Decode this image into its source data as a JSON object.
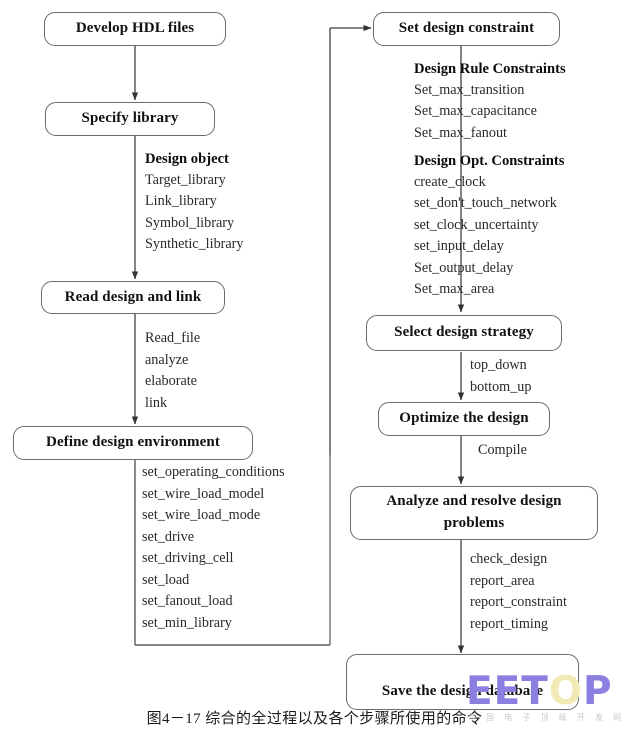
{
  "figure": {
    "caption": "图4－17  综合的全过程以及各个步骤所使用的命令",
    "watermark_main": "EETOP",
    "watermark_o": "O",
    "watermark_sub": "中 国 电 子 顶 级 开 发 网"
  },
  "nodes": {
    "develop_hdl": "Develop HDL files",
    "specify_library": "Specify library",
    "read_design": "Read design and link",
    "define_env": "Define design environment",
    "set_constraint": "Set design constraint",
    "select_strategy": "Select design strategy",
    "optimize": "Optimize the design",
    "analyze_line1": "Analyze and resolve design",
    "analyze_line2": "problems",
    "save_db": "Save the design database"
  },
  "lists": {
    "design_object": {
      "header": "Design object",
      "items": [
        "Target_library",
        "Link_library",
        "Symbol_library",
        "Synthetic_library"
      ]
    },
    "read_design_cmds": {
      "items": [
        "Read_file",
        "analyze",
        "elaborate",
        "link"
      ]
    },
    "define_env_cmds": {
      "items": [
        "set_operating_conditions",
        "set_wire_load_model",
        "set_wire_load_mode",
        "set_drive",
        "set_driving_cell",
        "set_load",
        "set_fanout_load",
        "set_min_library"
      ]
    },
    "design_rule_constraints": {
      "header": "Design Rule Constraints",
      "items": [
        "Set_max_transition",
        "Set_max_capacitance",
        "Set_max_fanout"
      ]
    },
    "design_opt_constraints": {
      "header": "Design Opt. Constraints",
      "items": [
        "create_clock",
        "set_don't_touch_network",
        "set_clock_uncertainty",
        "set_input_delay",
        "Set_output_delay",
        "Set_max_area"
      ]
    },
    "strategy_cmds": {
      "items": [
        "top_down",
        "bottom_up"
      ]
    },
    "optimize_cmds": {
      "items": [
        "Compile"
      ]
    },
    "analyze_cmds": {
      "items": [
        "check_design",
        "report_area",
        "report_constraint",
        "report_timing"
      ]
    }
  },
  "colors": {
    "line": "#5a5a5a",
    "box_border": "#6b6b6b",
    "text": "#111111",
    "watermark_purple": "#8b7fe0",
    "watermark_yellow": "#f2eab4"
  }
}
